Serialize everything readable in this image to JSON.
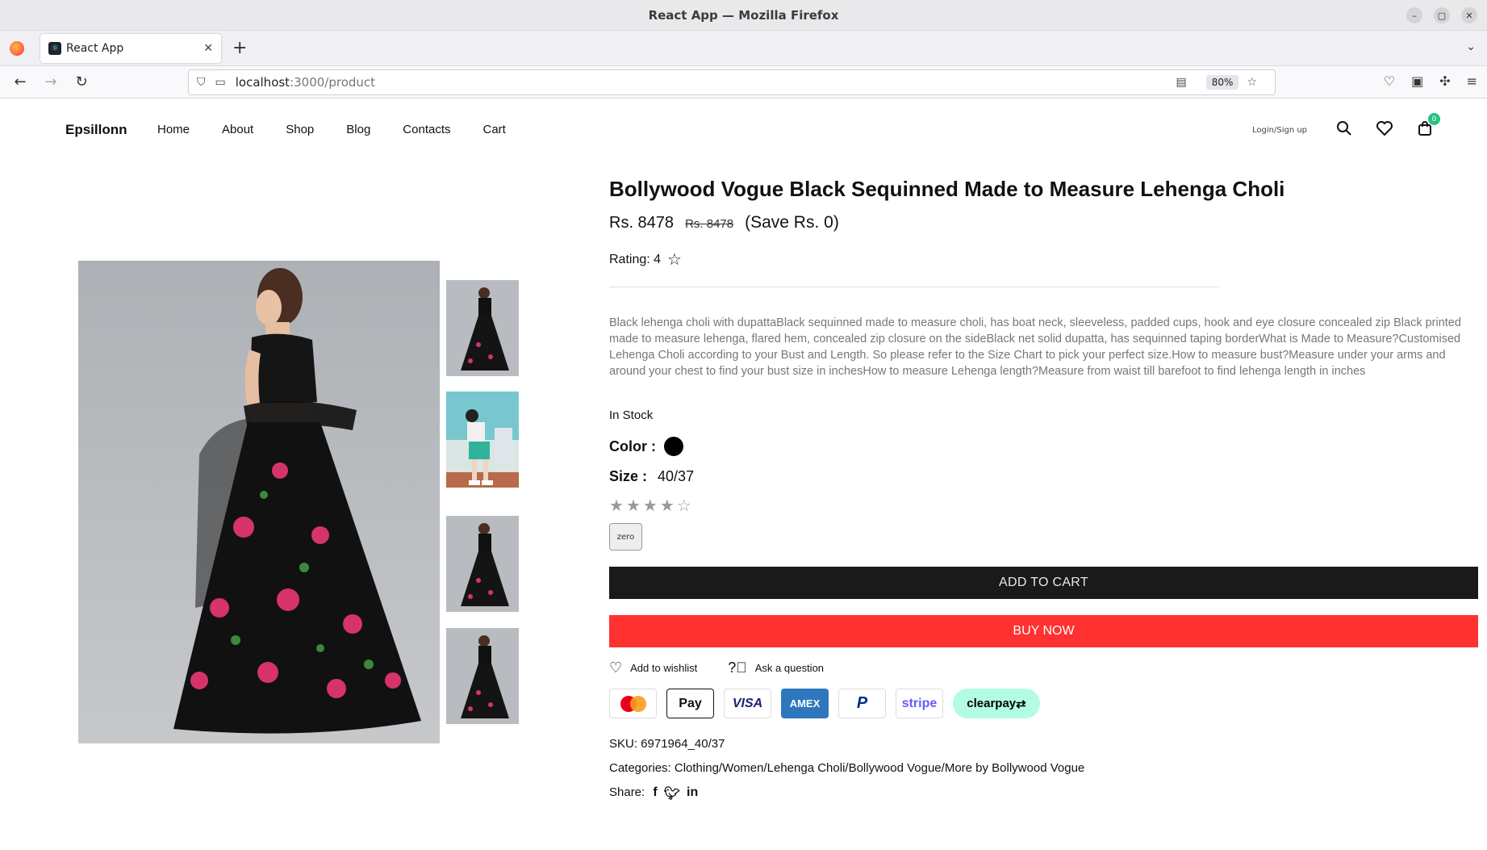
{
  "browser": {
    "window_title": "React App — Mozilla Firefox",
    "tab_title": "React App",
    "url_host": "localhost",
    "url_rest": ":3000/product",
    "zoom": "80%"
  },
  "site": {
    "brand": "Epsillonn",
    "menu": [
      "Home",
      "About",
      "Shop",
      "Blog",
      "Contacts",
      "Cart"
    ],
    "login": "Login/Sign up",
    "cart_count": "0"
  },
  "product": {
    "title": "Bollywood Vogue Black Sequinned Made to Measure Lehenga Choli",
    "price": "Rs. 8478",
    "old_price": "Rs. 8478",
    "save": "(Save Rs. 0)",
    "rating_label": "Rating: 4",
    "rating_value": 4,
    "rating_max": 5,
    "description": "Black lehenga choli with dupattaBlack sequinned made to measure choli, has boat neck, sleeveless, padded cups, hook and eye closure concealed zip Black printed made to measure lehenga, flared hem, concealed zip closure on the sideBlack net solid dupatta, has sequinned taping borderWhat is Made to Measure?Customised Lehenga Choli according to your Bust and Length. So please refer to the Size Chart to pick your perfect size.How to measure bust?Measure under your arms and around your chest to find your bust size in inchesHow to measure Lehenga length?Measure from waist till barefoot to find lehenga length in inches",
    "stock": "In Stock",
    "color_label": "Color :",
    "color_value": "#000000",
    "size_label": "Size :",
    "size_value": "40/37",
    "tag": "zero",
    "add_to_cart": "ADD TO CART",
    "buy_now": "BUY NOW",
    "wishlist": "Add to wishlist",
    "question": "Ask a question",
    "payments": [
      "mastercard",
      "Pay",
      "VISA",
      "AMEX",
      "paypal",
      "stripe",
      "clearpay"
    ],
    "sku": "SKU: 6971964_40/37",
    "categories": "Categories: Clothing/Women/Lehenga Choli/Bollywood Vogue/More by Bollywood Vogue",
    "share": "Share:",
    "share_icons": [
      "facebook-icon",
      "twitter-icon",
      "linkedin-icon"
    ]
  }
}
